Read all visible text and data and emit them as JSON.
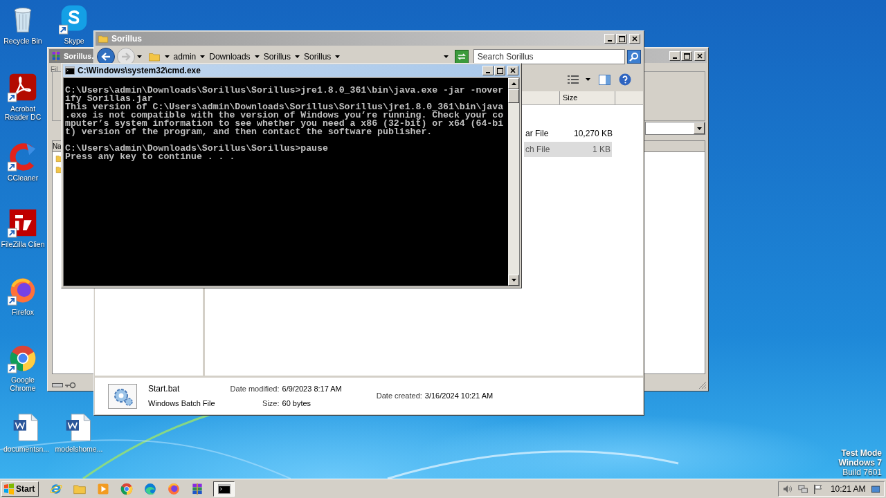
{
  "desktop_icons": [
    {
      "label": "Recycle Bin",
      "kind": "recycle",
      "shortcut": false
    },
    {
      "label": "Skype",
      "kind": "skype",
      "shortcut": true
    },
    {
      "label": "Acrobat Reader DC",
      "kind": "acrobat",
      "shortcut": true
    },
    {
      "label": "CCleaner",
      "kind": "ccleaner",
      "shortcut": true
    },
    {
      "label": "FileZilla Clien",
      "kind": "filezilla",
      "shortcut": true
    },
    {
      "label": "Firefox",
      "kind": "firefox",
      "shortcut": true
    },
    {
      "label": "Google Chrome",
      "kind": "chrome",
      "shortcut": true
    },
    {
      "label": "documentsn...",
      "kind": "word",
      "shortcut": false
    },
    {
      "label": "modelshome...",
      "kind": "word",
      "shortcut": false
    }
  ],
  "archive_window": {
    "title": "Sorillus.",
    "menu_item": "Fil",
    "column_header": "Na"
  },
  "explorer": {
    "title": "Sorillus",
    "breadcrumb": [
      "admin",
      "Downloads",
      "Sorillus",
      "Sorillus"
    ],
    "search": {
      "placeholder": "Search Sorillus"
    },
    "column_header": "Size",
    "rows": [
      {
        "type": "ar File",
        "size": "10,270 KB",
        "selected": false
      },
      {
        "type": "ch File",
        "size": "1 KB",
        "selected": true
      }
    ],
    "details": {
      "name": "Start.bat",
      "type": "Windows Batch File",
      "columns": [
        [
          {
            "label": "Date modified:",
            "value": "6/9/2023 8:17 AM"
          },
          {
            "label": "Size:",
            "value": "60 bytes"
          }
        ],
        [
          {
            "label": "Date created:",
            "value": "3/16/2024 10:21 AM"
          }
        ]
      ]
    }
  },
  "console": {
    "title": "C:\\Windows\\system32\\cmd.exe",
    "blocks": [
      [
        "C:\\Users\\admin\\Downloads\\Sorillus\\Sorillus>jre1.8.0_361\\bin\\java.exe -jar -nover",
        "ify Sorillas.jar",
        "This version of C:\\Users\\admin\\Downloads\\Sorillus\\Sorillus\\jre1.8.0_361\\bin\\java",
        ".exe is not compatible with the version of Windows you’re running. Check your co",
        "mputer’s system information to see whether you need a x86 (32-bit) or x64 (64-bi",
        "t) version of the program, and then contact the software publisher."
      ],
      [
        "C:\\Users\\admin\\Downloads\\Sorillus\\Sorillus>pause",
        "Press any key to continue . . ."
      ]
    ]
  },
  "system_info": [
    "Test Mode",
    "Windows 7",
    "Build 7601"
  ],
  "taskbar": {
    "start": "Start",
    "apps": [
      {
        "kind": "ie",
        "active": false
      },
      {
        "kind": "explorer",
        "active": false
      },
      {
        "kind": "media",
        "active": false
      },
      {
        "kind": "chrome",
        "active": false
      },
      {
        "kind": "edge",
        "active": false
      },
      {
        "kind": "firefox",
        "active": false
      },
      {
        "kind": "winrar",
        "active": false
      },
      {
        "kind": "cmd",
        "active": true
      }
    ],
    "clock": "10:21 AM"
  }
}
